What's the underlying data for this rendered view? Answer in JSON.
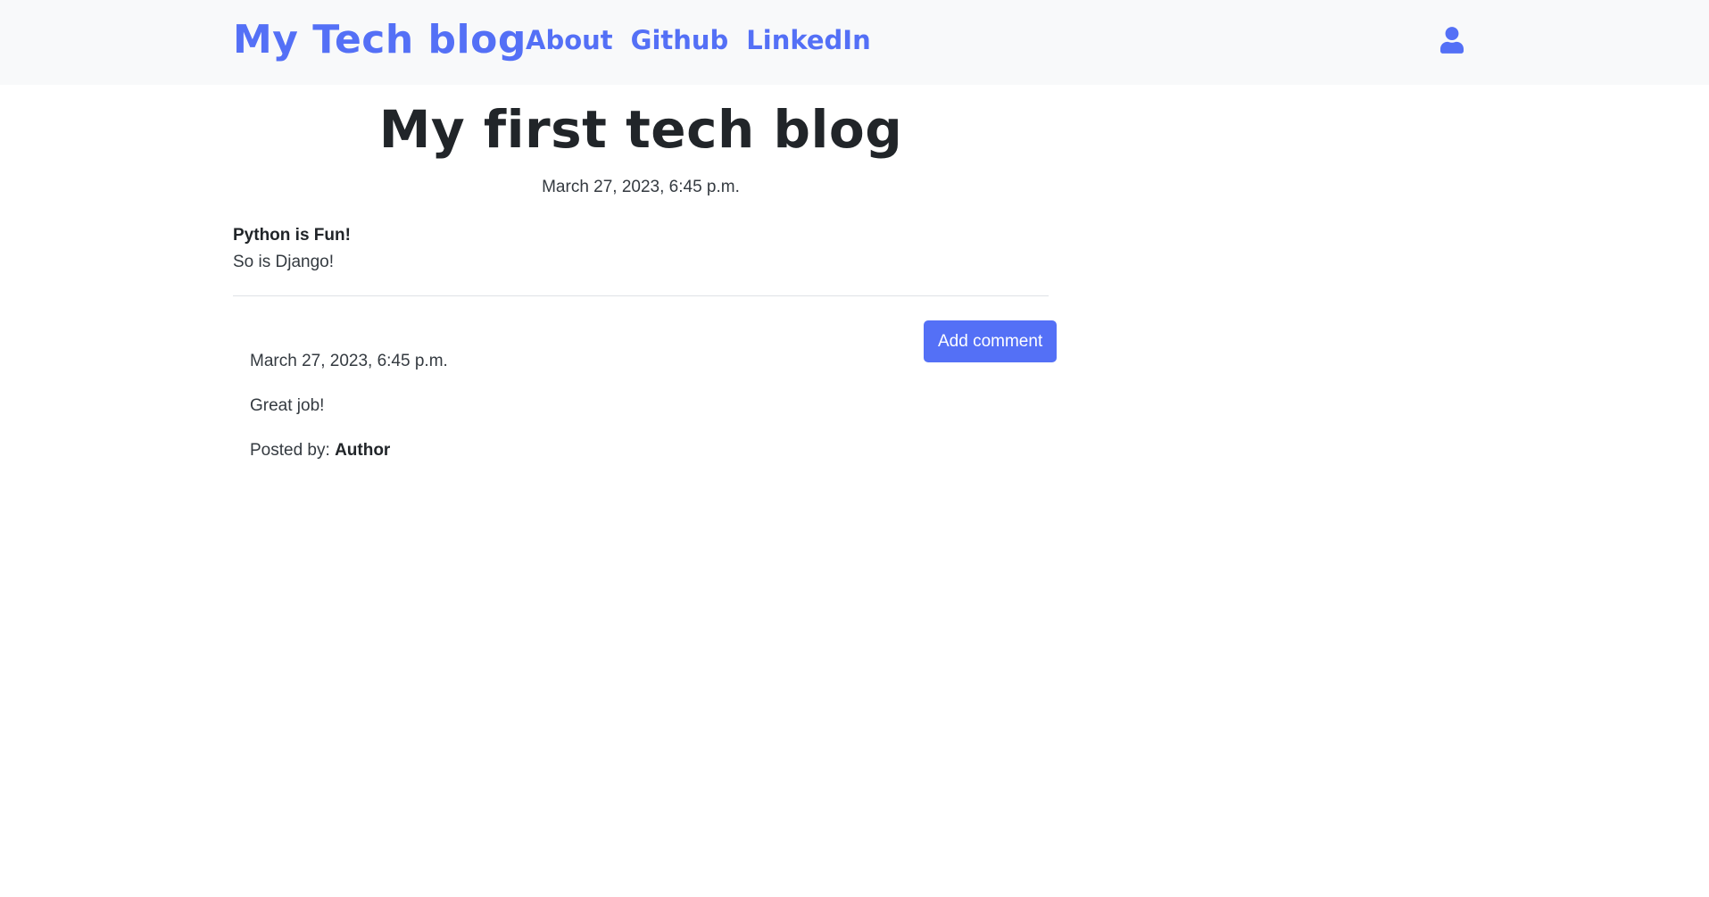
{
  "nav": {
    "brand": "My Tech blog",
    "links": [
      "About",
      "Github",
      "LinkedIn"
    ],
    "user_icon": "user-icon",
    "accent_color": "#5470f6"
  },
  "post": {
    "title": "My first tech blog",
    "date": "March 27, 2023, 6:45 p.m.",
    "heading": "Python is Fun!",
    "body": "So is Django!"
  },
  "comments": {
    "add_button": "Add comment",
    "items": [
      {
        "date": "March 27, 2023, 6:45 p.m.",
        "text": "Great job!",
        "posted_by_label": "Posted by:",
        "author": "Author"
      }
    ]
  }
}
